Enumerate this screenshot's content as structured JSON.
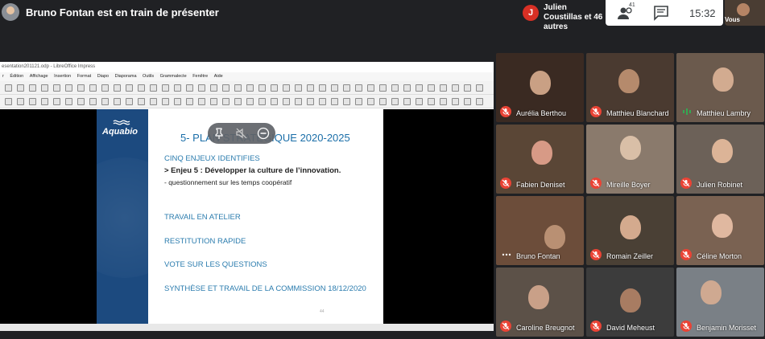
{
  "header": {
    "presenting_text": "Bruno Fontan est en train de présenter",
    "people_avatar_letter": "J",
    "people_names": "Julien Coustillas et 46 autres",
    "participant_count": "41",
    "clock": "15:32",
    "self_label": "Vous"
  },
  "shared_screen": {
    "app_title": "esentation201121.odp - LibreOffice Impress",
    "menu": [
      "r",
      "Édition",
      "Affichage",
      "Insertion",
      "Format",
      "Diapo",
      "Diaporama",
      "Outils",
      "Grammalecte",
      "Fenêtre",
      "Aide"
    ],
    "slide": {
      "logo": "Aquabio",
      "title": "5- PLAN STRATÉGIQUE 2020-2025",
      "line1": "CINQ ENJEUX IDENTIFIES",
      "line2": "> Enjeu 5 : Développer la culture de l’innovation.",
      "line3": "-  questionnement sur les temps coopératif",
      "line4": "TRAVAIL EN ATELIER",
      "line5": "RESTITUTION RAPIDE",
      "line6": "VOTE SUR LES QUESTIONS",
      "line7": "SYNTHÈSE ET TRAVAIL DE LA COMMISSION 18/12/2020",
      "page_number": "44"
    }
  },
  "participants": [
    {
      "name": "Aurélia Berthou",
      "bg": "#3a2a22",
      "face": "#c9a084",
      "muted": true
    },
    {
      "name": "Matthieu Blanchard",
      "bg": "#4a3a30",
      "face": "#b58a6c",
      "muted": true
    },
    {
      "name": "Matthieu Lambry",
      "bg": "#6b5a4d",
      "face": "#d2ab90",
      "muted": false
    },
    {
      "name": "Fabien Deniset",
      "bg": "#5a4636",
      "face": "#d79a86",
      "muted": true
    },
    {
      "name": "Mireille Boyer",
      "bg": "#8a7a6c",
      "face": "#d9bfa7",
      "muted": true
    },
    {
      "name": "Julien Robinet",
      "bg": "#6c6158",
      "face": "#dcb497",
      "muted": true
    },
    {
      "name": "Bruno Fontan",
      "bg": "#6c4d3a",
      "face": "#b99073",
      "muted": false
    },
    {
      "name": "Romain Zeiller",
      "bg": "#4a4035",
      "face": "#d4aa8e",
      "muted": true
    },
    {
      "name": "Céline Morton",
      "bg": "#7a6252",
      "face": "#e0b8a0",
      "muted": true
    },
    {
      "name": "Caroline Breugnot",
      "bg": "#5c5148",
      "face": "#c9a088",
      "muted": true
    },
    {
      "name": "David Meheust",
      "bg": "#3c3c3c",
      "face": "#a87c62",
      "muted": true
    },
    {
      "name": "Benjamin Morisset",
      "bg": "#7a8086",
      "face": "#cfa991",
      "muted": true
    }
  ],
  "colors": {
    "background": "#202124",
    "mute_red": "#ea4335",
    "slide_blue": "#1c4a7f",
    "title_blue": "#1a6ea8"
  },
  "icons": {
    "pin": "pin-icon",
    "mute_presentation": "volume-off-icon",
    "remove": "remove-icon",
    "people": "people-icon",
    "chat": "chat-icon"
  }
}
